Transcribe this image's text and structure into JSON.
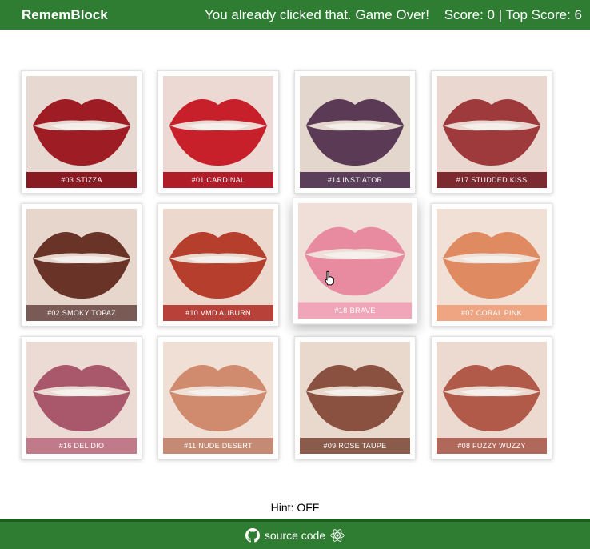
{
  "header": {
    "brand": "RememBlock",
    "message": "You already clicked that. Game Over!",
    "score_text": "Score: 0 | Top Score: 6"
  },
  "cards": [
    {
      "label": "#03 STIZZA",
      "color": "#9e1c24",
      "bar": "#8a1a22",
      "bg": "#e8d8d2"
    },
    {
      "label": "#01 CARDINAL",
      "color": "#c8202a",
      "bar": "#b01c28",
      "bg": "#ecd9d3"
    },
    {
      "label": "#14 INSTIATOR",
      "color": "#5a3a55",
      "bar": "#5b3f5a",
      "bg": "#e2d6cd"
    },
    {
      "label": "#17 STUDDED KISS",
      "color": "#9e3a3c",
      "bar": "#7c2a30",
      "bg": "#ead8d0"
    },
    {
      "label": "#02 SMOKY TOPAZ",
      "color": "#6a3328",
      "bar": "#7a5a55",
      "bg": "#e6d6cc"
    },
    {
      "label": "#10 VMD AUBURN",
      "color": "#b53e2c",
      "bar": "#b8423a",
      "bg": "#ecd8cc"
    },
    {
      "label": "#18 BRAVE",
      "color": "#e88aa0",
      "bar": "#f0a5b8",
      "bg": "#f0ded9"
    },
    {
      "label": "#07 CORAL PINK",
      "color": "#e08a62",
      "bar": "#f0a582",
      "bg": "#f0e0d6"
    },
    {
      "label": "#16 DEL DIO",
      "color": "#a8586a",
      "bar": "#c07a8a",
      "bg": "#ecdad4"
    },
    {
      "label": "#11 NUDE DESERT",
      "color": "#d08a6e",
      "bar": "#c58a74",
      "bg": "#efdfd4"
    },
    {
      "label": "#09 ROSE TAUPE",
      "color": "#8a5040",
      "bar": "#8a5a4a",
      "bg": "#e9d8cc"
    },
    {
      "label": "#08 FUZZY WUZZY",
      "color": "#b25a4a",
      "bar": "#b0685a",
      "bg": "#ecd9cf"
    }
  ],
  "hint": "Hint: OFF",
  "footer": {
    "link_text": "source code",
    "github_icon": "github-icon",
    "react_icon": "react-icon"
  }
}
